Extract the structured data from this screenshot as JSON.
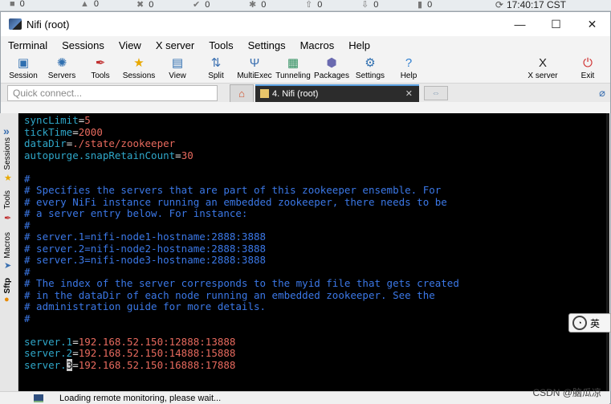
{
  "status_strip": {
    "items": [
      {
        "icon": "square-icon",
        "value": "0"
      },
      {
        "icon": "warning-icon",
        "value": "0"
      },
      {
        "icon": "error-icon",
        "value": "0"
      },
      {
        "icon": "check-icon",
        "value": "0"
      },
      {
        "icon": "gear-icon",
        "value": "0"
      },
      {
        "icon": "upload-icon",
        "value": "0"
      },
      {
        "icon": "download-icon",
        "value": "0"
      },
      {
        "icon": "device-icon",
        "value": "0"
      }
    ],
    "clock": "17:40:17 CST"
  },
  "window": {
    "title": "Nifi (root)",
    "minimize": "—",
    "maximize": "☐",
    "close": "✕"
  },
  "menu": [
    "Terminal",
    "Sessions",
    "View",
    "X server",
    "Tools",
    "Settings",
    "Macros",
    "Help"
  ],
  "toolbar": {
    "items": [
      {
        "label": "Session",
        "icon": "session-icon",
        "glyph": "▣"
      },
      {
        "label": "Servers",
        "icon": "servers-icon",
        "glyph": "✺"
      },
      {
        "label": "Tools",
        "icon": "tools-icon",
        "glyph": "✒"
      },
      {
        "label": "Sessions",
        "icon": "star-icon",
        "glyph": "★"
      },
      {
        "label": "View",
        "icon": "view-icon",
        "glyph": "▤"
      },
      {
        "label": "Split",
        "icon": "split-icon",
        "glyph": "⇅"
      },
      {
        "label": "MultiExec",
        "icon": "multiexec-icon",
        "glyph": "Ψ"
      },
      {
        "label": "Tunneling",
        "icon": "tunneling-icon",
        "glyph": "▦"
      },
      {
        "label": "Packages",
        "icon": "packages-icon",
        "glyph": "⬢"
      },
      {
        "label": "Settings",
        "icon": "settings-icon",
        "glyph": "⚙"
      },
      {
        "label": "Help",
        "icon": "help-icon",
        "glyph": "?"
      }
    ],
    "right": [
      {
        "label": "X server",
        "icon": "x-server-icon",
        "glyph": "X"
      },
      {
        "label": "Exit",
        "icon": "exit-icon",
        "glyph": "⏻"
      }
    ]
  },
  "tabs": {
    "quick_connect_placeholder": "Quick connect...",
    "active_tab": "4. Nifi (root)",
    "close": "✕"
  },
  "side_panel": {
    "labels": [
      "Sessions",
      "Tools",
      "Macros",
      "Sftp"
    ]
  },
  "terminal": {
    "lines": [
      {
        "key": "syncLimit",
        "value": "5"
      },
      {
        "key": "tickTime",
        "value": "2000"
      },
      {
        "key": "dataDir",
        "value": "./state/zookeeper"
      },
      {
        "key": "autopurge.snapRetainCount",
        "value": "30"
      },
      {
        "comment": ""
      },
      {
        "comment": "#"
      },
      {
        "comment": "# Specifies the servers that are part of this zookeeper ensemble. For"
      },
      {
        "comment": "# every NiFi instance running an embedded zookeeper, there needs to be"
      },
      {
        "comment": "# a server entry below. For instance:"
      },
      {
        "comment": "#"
      },
      {
        "comment": "# server.1=nifi-node1-hostname:2888:3888"
      },
      {
        "comment": "# server.2=nifi-node2-hostname:2888:3888"
      },
      {
        "comment": "# server.3=nifi-node3-hostname:2888:3888"
      },
      {
        "comment": "#"
      },
      {
        "comment": "# The index of the server corresponds to the myid file that gets created"
      },
      {
        "comment": "# in the dataDir of each node running an embedded zookeeper. See the"
      },
      {
        "comment": "# administration guide for more details."
      },
      {
        "comment": "#"
      },
      {
        "comment": ""
      },
      {
        "key": "server.1",
        "value": "192.168.52.150:12888:13888"
      },
      {
        "key": "server.2",
        "value": "192.168.52.150:14888:15888"
      },
      {
        "key": "server.",
        "cursor": "3",
        "value": "192.168.52.150:16888:17888"
      }
    ]
  },
  "floating_button": {
    "label": "英"
  },
  "statusbar": {
    "message": "Loading remote monitoring, please wait..."
  },
  "watermark": "CSDN @脑瓜凉"
}
